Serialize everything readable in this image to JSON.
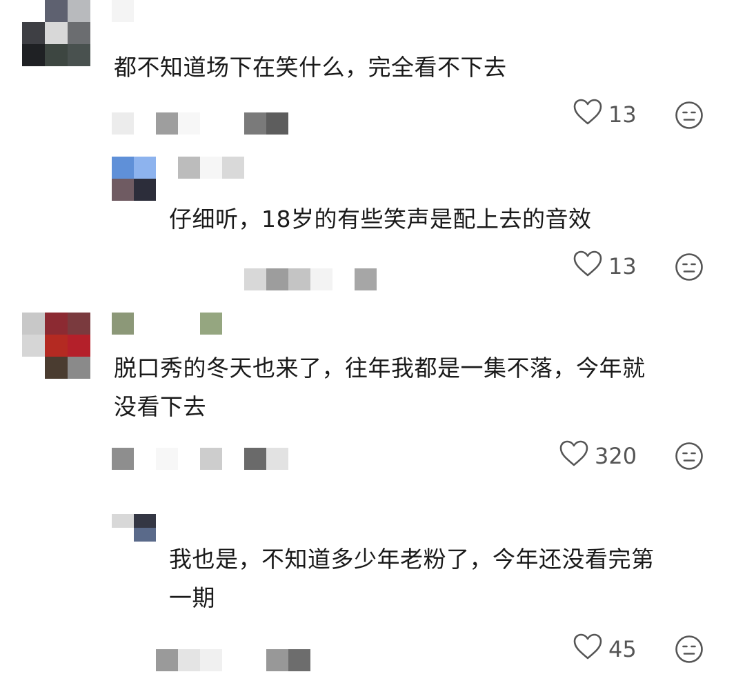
{
  "comments": [
    {
      "text_lines": [
        "都不知道场下在笑什么，完全看不下去"
      ],
      "likes": "13",
      "replies": [
        {
          "text_lines": [
            "仔细听，18岁的有些笑声是配上去的音效"
          ],
          "likes": "13"
        }
      ]
    },
    {
      "text_lines": [
        "脱口秀的冬天也来了，往年我都是一集不落，今年就",
        "没看下去"
      ],
      "likes": "320",
      "replies": [
        {
          "text_lines": [
            "我也是，不知道多少年老粉了，今年还没看完第",
            "一期"
          ],
          "likes": "45"
        }
      ]
    }
  ],
  "icons": {
    "like": "heart-outline-icon",
    "dislike": "neutral-face-icon"
  },
  "colors": {
    "text": "#1a1a1a",
    "icon": "#555555"
  }
}
